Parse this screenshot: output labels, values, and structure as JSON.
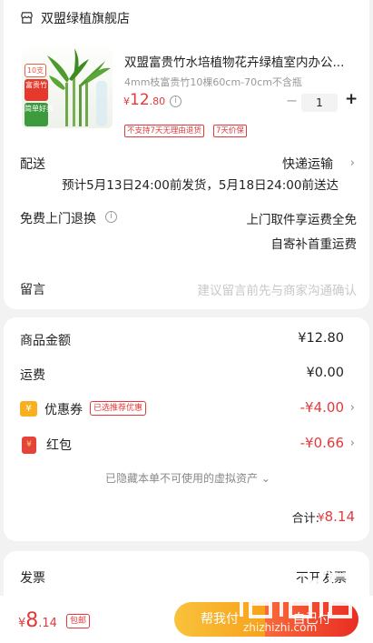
{
  "shop": {
    "name": "双盟绿植旗舰店",
    "icon": "shop-icon"
  },
  "product": {
    "title": "双盟富贵竹水培植物花卉绿植室内办公...",
    "spec": "4mm枝富贵竹10棵60cm-70cm不含瓶",
    "price_currency": "¥",
    "price_int": "12",
    "price_dec": ".80",
    "quantity": "1",
    "minus": "−",
    "plus": "+",
    "badges": [
      "不支持7天无理由退货",
      "7天价保"
    ],
    "image_tags": {
      "count": "10支",
      "red_tag": "富贵竹",
      "green_tag": "简单好养"
    }
  },
  "delivery": {
    "label": "配送",
    "value": "快递运输",
    "estimate": "预计5月13日24:00前发货，5月18日24:00前送达"
  },
  "returns": {
    "label": "免费上门退换",
    "line1": "上门取件享运费全免",
    "line2": "自寄补首重运费"
  },
  "remark": {
    "label": "留言",
    "placeholder": "建议留言前先与商家沟通确认"
  },
  "price_detail": {
    "goods_label": "商品金额",
    "goods_value": "¥12.80",
    "shipping_label": "运费",
    "shipping_value": "¥0.00",
    "coupon_label": "优惠券",
    "coupon_tag": "已选推荐优惠",
    "coupon_value": "-¥4.00",
    "hongbao_label": "红包",
    "hongbao_value": "-¥0.66",
    "hidden_note": "已隐藏本单不可使用的虚拟资产",
    "total_label": "合计:",
    "total_currency": "¥",
    "total_value": "8.14"
  },
  "invoice": {
    "label": "发票",
    "value": "不开发票"
  },
  "bottom": {
    "price_currency": "¥",
    "price_int": "8",
    "price_dec": ".14",
    "tag": "包邮",
    "help_pay": "帮我付",
    "self_pay": "自己付"
  },
  "watermark": {
    "text": "zhizhizhi.com"
  },
  "colors": {
    "accent_red": "#e4393c",
    "help_yellow": "#f7a21b",
    "pay_red": "#e92d24"
  }
}
